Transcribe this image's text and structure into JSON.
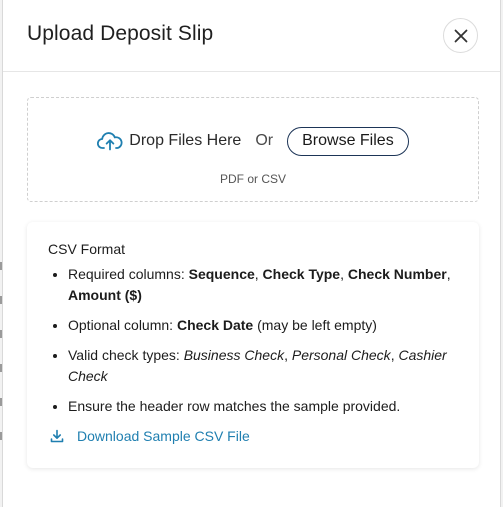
{
  "modal": {
    "title": "Upload Deposit Slip",
    "close_icon": "close-icon"
  },
  "dropzone": {
    "upload_icon": "cloud-upload-icon",
    "drop_label": "Drop Files Here",
    "or_label": "Or",
    "browse_label": "Browse Files",
    "file_types": "PDF or CSV"
  },
  "csv_format": {
    "title": "CSV Format",
    "items": [
      {
        "parts": [
          {
            "text": "Required columns: ",
            "style": "normal"
          },
          {
            "text": "Sequence",
            "style": "bold"
          },
          {
            "text": ", ",
            "style": "normal"
          },
          {
            "text": "Check Type",
            "style": "bold"
          },
          {
            "text": ", ",
            "style": "normal"
          },
          {
            "text": "Check Number",
            "style": "bold"
          },
          {
            "text": ", ",
            "style": "normal"
          },
          {
            "text": "Amount ($)",
            "style": "bold"
          }
        ]
      },
      {
        "parts": [
          {
            "text": "Optional column: ",
            "style": "normal"
          },
          {
            "text": "Check Date",
            "style": "bold"
          },
          {
            "text": " (may be left empty)",
            "style": "normal"
          }
        ]
      },
      {
        "parts": [
          {
            "text": "Valid check types: ",
            "style": "normal"
          },
          {
            "text": "Business Check",
            "style": "italic"
          },
          {
            "text": ", ",
            "style": "normal"
          },
          {
            "text": "Personal Check",
            "style": "italic"
          },
          {
            "text": ", ",
            "style": "normal"
          },
          {
            "text": "Cashier Check",
            "style": "italic"
          }
        ]
      },
      {
        "parts": [
          {
            "text": "Ensure the header row matches the sample provided.",
            "style": "normal"
          }
        ]
      }
    ],
    "download_icon": "download-icon",
    "download_label": "Download Sample CSV File"
  },
  "colors": {
    "accent_link": "#1f7fb0",
    "upload_icon": "#1f7fb0",
    "browse_border": "#1d3557"
  }
}
